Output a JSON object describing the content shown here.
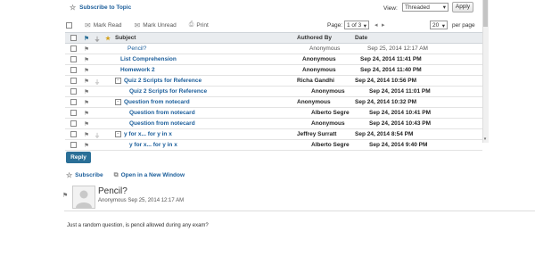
{
  "topic": {
    "subscribe_label": "Subscribe to Topic"
  },
  "view": {
    "label": "View:",
    "selected": "Threaded",
    "apply_label": "Apply"
  },
  "toolbar": {
    "mark_read": "Mark Read",
    "mark_unread": "Mark Unread",
    "print": "Print"
  },
  "pager": {
    "label": "Page:",
    "selected": "1 of 3",
    "per_page_value": "20",
    "per_page_label": "per page"
  },
  "columns": {
    "subject": "Subject",
    "authored_by": "Authored By",
    "date": "Date"
  },
  "rows": [
    {
      "subject": "Pencil?",
      "author": "Anonymous",
      "date": "Sep 25, 2014 12:17 AM"
    },
    {
      "subject": "List Comprehension",
      "author": "Anonymous",
      "date": "Sep 24, 2014 11:41 PM"
    },
    {
      "subject": "Homework 2",
      "author": "Anonymous",
      "date": "Sep 24, 2014 11:40 PM"
    },
    {
      "subject": "Quiz 2 Scripts for Reference",
      "author": "Richa Gandhi",
      "date": "Sep 24, 2014 10:56 PM"
    },
    {
      "subject": "Quiz 2 Scripts for Reference",
      "author": "Anonymous",
      "date": "Sep 24, 2014 11:01 PM"
    },
    {
      "subject": "Question from notecard",
      "author": "Anonymous",
      "date": "Sep 24, 2014 10:32 PM"
    },
    {
      "subject": "Question from notecard",
      "author": "Alberto Segre",
      "date": "Sep 24, 2014 10:41 PM"
    },
    {
      "subject": "Question from notecard",
      "author": "Anonymous",
      "date": "Sep 24, 2014 10:43 PM"
    },
    {
      "subject": "y for x... for y in x",
      "author": "Jeffrey Surratt",
      "date": "Sep 24, 2014 8:54 PM"
    },
    {
      "subject": "y for x... for y in x",
      "author": "Alberto Segre",
      "date": "Sep 24, 2014 9:40 PM"
    }
  ],
  "reply_label": "Reply",
  "post_actions": {
    "subscribe": "Subscribe",
    "open_new_window": "Open in a New Window"
  },
  "post": {
    "title": "Pencil?",
    "meta": "Anonymous Sep 25, 2014 12:17 AM",
    "body": "Just a random question, is pencil allowed during any exam?"
  },
  "colors": {
    "link": "#1a5d9a",
    "reply_button": "#2a6f97",
    "header_bg": "#e9ecef"
  }
}
